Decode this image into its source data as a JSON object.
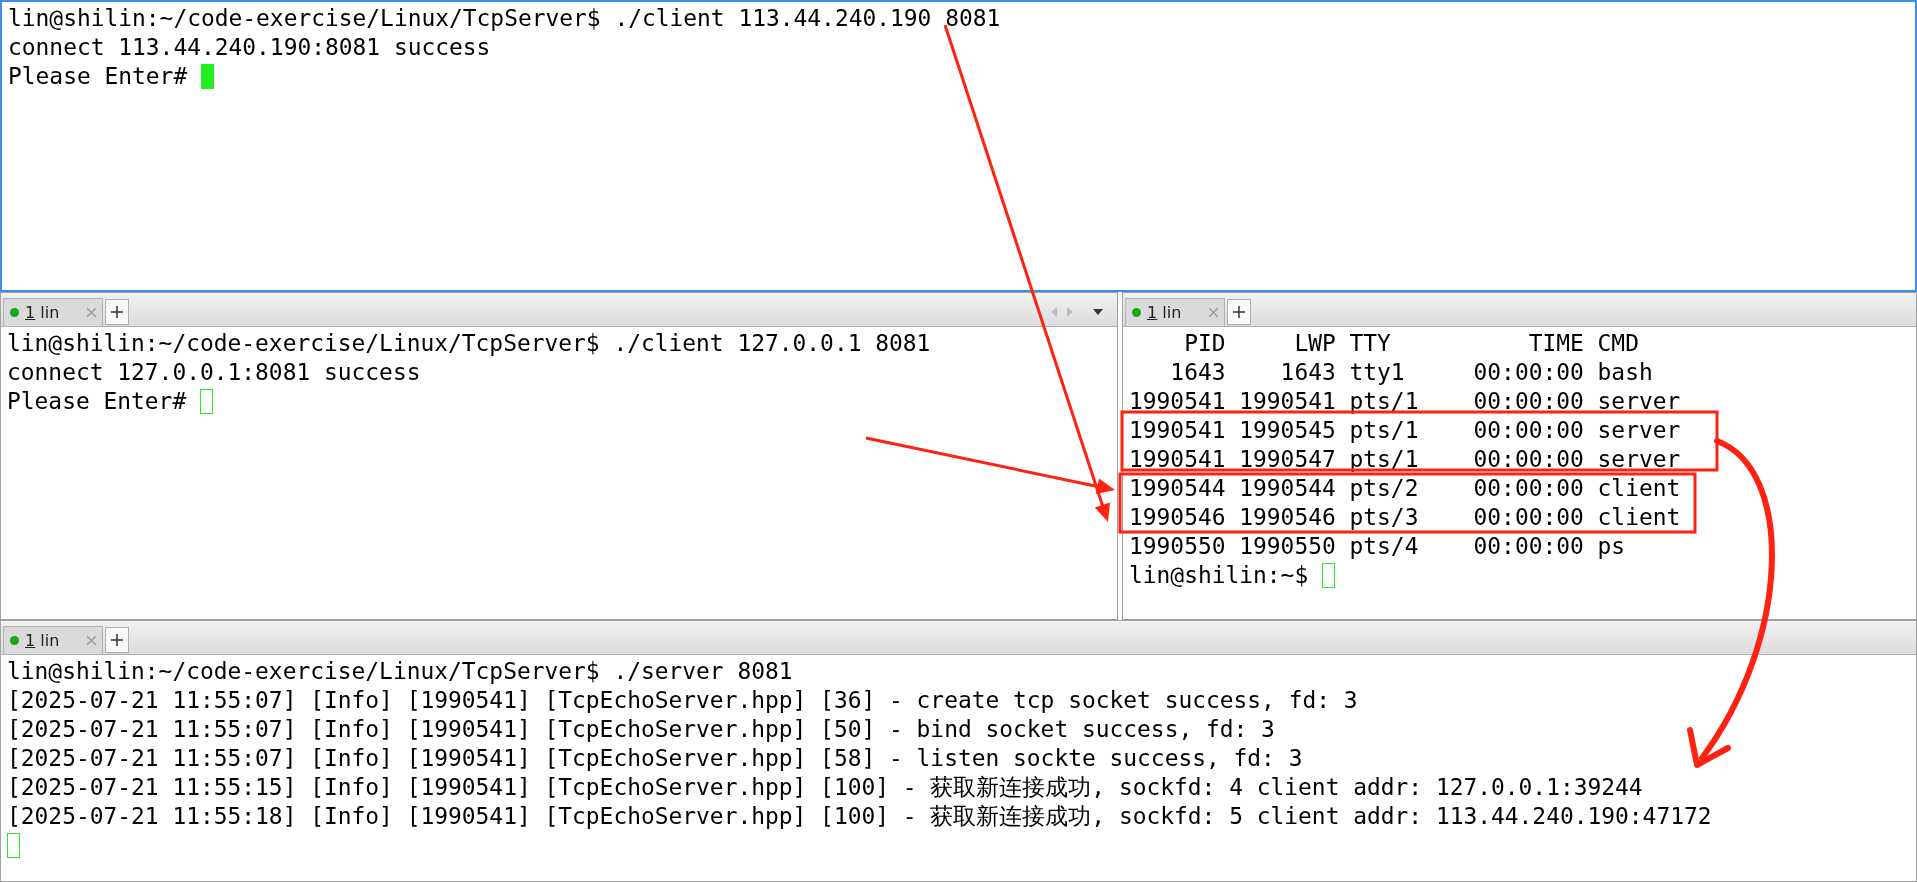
{
  "panes": [
    {
      "focused": true,
      "cursor_newline": false,
      "lines": [
        "lin@shilin:~/code-exercise/Linux/TcpServer$ ./client 113.44.240.190 8081",
        "connect 113.44.240.190:8081 success",
        "Please Enter# "
      ]
    },
    {
      "focused": false,
      "cursor_newline": false,
      "tabs": [
        {
          "label": "1 lin",
          "selected": true
        }
      ],
      "tab_scroll": true,
      "lines": [
        "lin@shilin:~/code-exercise/Linux/TcpServer$ ./client 127.0.0.1 8081",
        "connect 127.0.0.1:8081 success",
        "Please Enter# "
      ]
    },
    {
      "focused": false,
      "cursor_newline": false,
      "tabs": [
        {
          "label": "1 lin",
          "selected": true
        }
      ],
      "tab_scroll": false,
      "lines": [
        "    PID     LWP TTY          TIME CMD",
        "   1643    1643 tty1     00:00:00 bash",
        "1990541 1990541 pts/1    00:00:00 server",
        "1990541 1990545 pts/1    00:00:00 server",
        "1990541 1990547 pts/1    00:00:00 server",
        "1990544 1990544 pts/2    00:00:00 client",
        "1990546 1990546 pts/3    00:00:00 client",
        "1990550 1990550 pts/4    00:00:00 ps",
        "lin@shilin:~$ "
      ]
    },
    {
      "focused": false,
      "cursor_newline": true,
      "tabs": [
        {
          "label": "1 lin",
          "selected": true
        }
      ],
      "tab_scroll": false,
      "lines": [
        "lin@shilin:~/code-exercise/Linux/TcpServer$ ./server 8081",
        "[2025-07-21 11:55:07] [Info] [1990541] [TcpEchoServer.hpp] [36] - create tcp socket success, fd: 3",
        "[2025-07-21 11:55:07] [Info] [1990541] [TcpEchoServer.hpp] [50] - bind socket success, fd: 3",
        "[2025-07-21 11:55:07] [Info] [1990541] [TcpEchoServer.hpp] [58] - listen sockte success, fd: 3",
        "[2025-07-21 11:55:15] [Info] [1990541] [TcpEchoServer.hpp] [100] - 获取新连接成功, sockfd: 4 client addr: 127.0.0.1:39244",
        "[2025-07-21 11:55:18] [Info] [1990541] [TcpEchoServer.hpp] [100] - 获取新连接成功, sockfd: 5 client addr: 113.44.240.190:47172"
      ]
    }
  ]
}
